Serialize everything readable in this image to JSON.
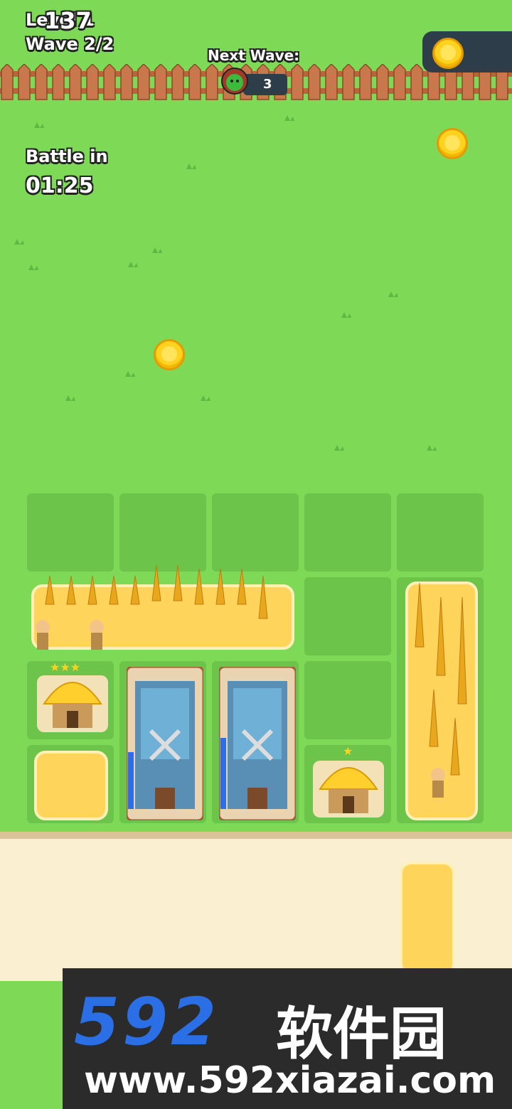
{
  "hud": {
    "level": "Level 1",
    "wave": "Wave 2/2",
    "next_wave_label": "Next Wave:",
    "next_wave_enemies": "3",
    "battle_label": "Battle in",
    "battle_timer": "01:25",
    "coins": "137"
  },
  "watermark": {
    "brand": "592",
    "chinese": "软件园",
    "url": "www.592xiazai.com"
  },
  "colors": {
    "grass": "#7ed957",
    "tile": "#6cc44a",
    "wheat_field": "#ffd45a",
    "panel_dark": "#2d3e4a",
    "coin": "#ffd21f"
  }
}
